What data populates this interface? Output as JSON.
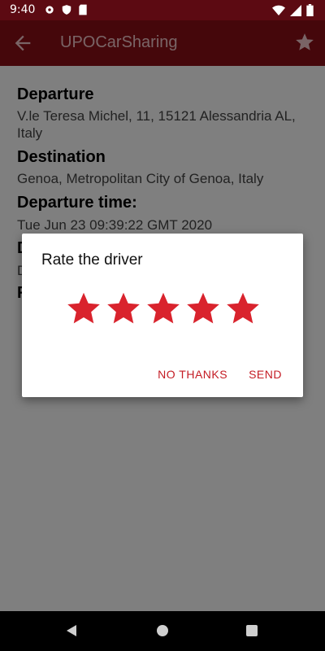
{
  "status_bar": {
    "time": "9:40",
    "icons_left": [
      "settings-icon",
      "shield-icon",
      "sd-card-icon"
    ],
    "icons_right": [
      "wifi-icon",
      "signal-icon",
      "battery-icon"
    ]
  },
  "app_bar": {
    "title": "UPOCarSharing",
    "back_icon": "arrow-back-icon",
    "action_icon": "star-icon"
  },
  "ride": {
    "departure_label": "Departure",
    "departure_value": "V.le Teresa Michel, 11, 15121 Alessandria AL, Italy",
    "destination_label": "Destination",
    "destination_value": "Genoa, Metropolitan City of Genoa, Italy",
    "time_label": "Departure time:",
    "time_value": "Tue Jun 23 09:39:22 GMT 2020",
    "obscured_label_1_initial": "D",
    "obscured_value_1_initial": "D",
    "obscured_label_2_initial": "F"
  },
  "dialog": {
    "title": "Rate the driver",
    "rating": {
      "value": 5,
      "max": 5
    },
    "no_thanks_label": "NO THANKS",
    "send_label": "SEND"
  },
  "colors": {
    "status_bar": "#5c0a12",
    "app_bar": "#8b0e16",
    "accent": "#c41c24",
    "star": "#d9232d"
  },
  "nav_bar": {
    "icons": [
      "nav-back-icon",
      "nav-home-icon",
      "nav-recents-icon"
    ]
  }
}
